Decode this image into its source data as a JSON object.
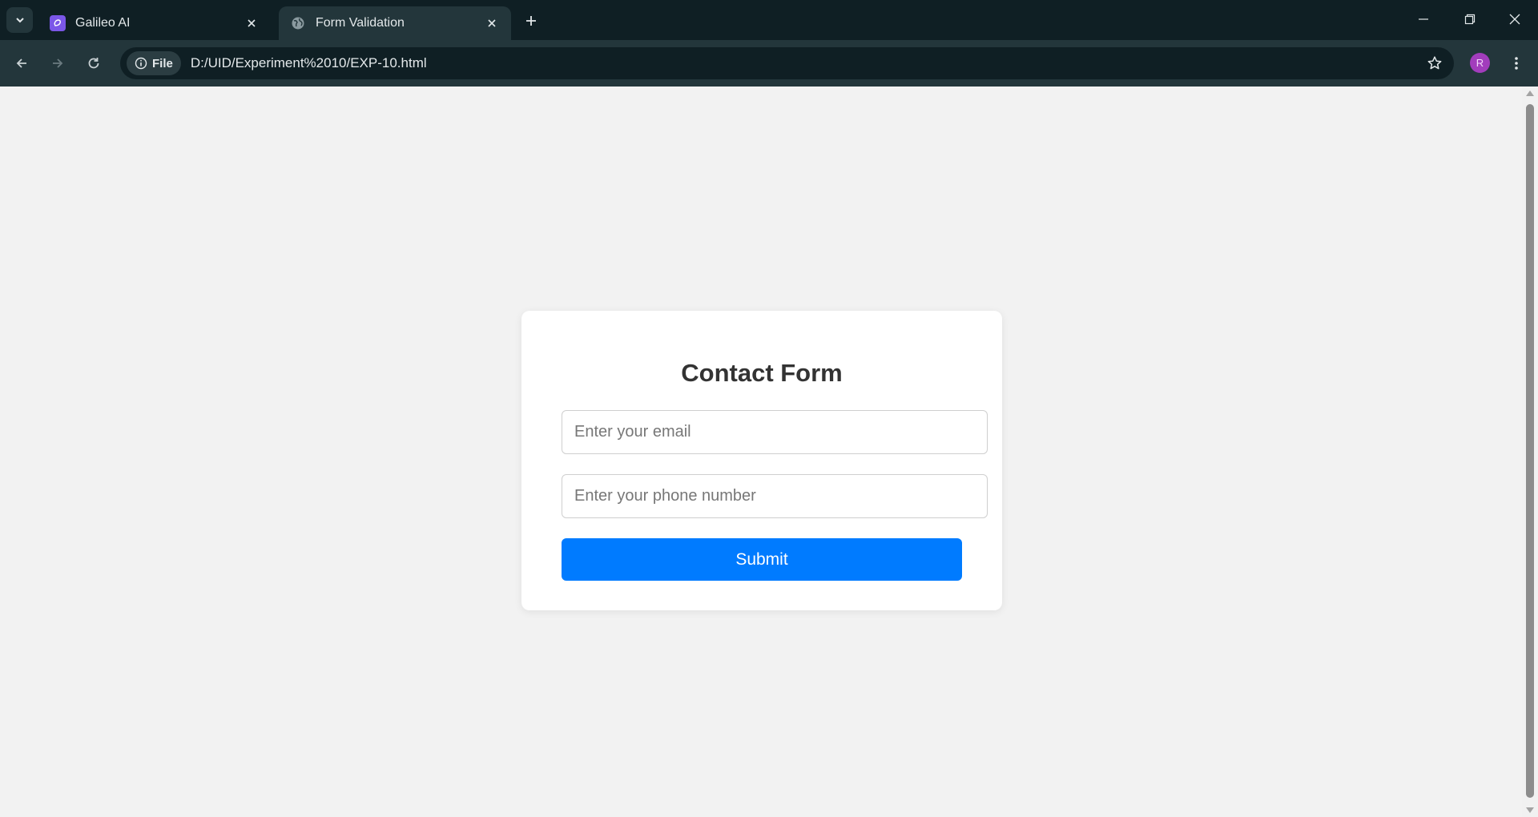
{
  "browser": {
    "tabs": [
      {
        "title": "Galileo AI",
        "icon": "galileo-logo-icon",
        "active": false
      },
      {
        "title": "Form Validation",
        "icon": "globe-icon",
        "active": true
      }
    ],
    "address_bar": {
      "chip_label": "File",
      "url": "D:/UID/Experiment%2010/EXP-10.html"
    },
    "profile_initial": "R"
  },
  "page": {
    "form": {
      "title": "Contact Form",
      "email_placeholder": "Enter your email",
      "email_value": "",
      "phone_placeholder": "Enter your phone number",
      "phone_value": "",
      "submit_label": "Submit"
    }
  },
  "colors": {
    "accent": "#007bff",
    "page_background": "#f2f2f2",
    "browser_frame": "#0f1f24",
    "toolbar": "#23363b"
  }
}
